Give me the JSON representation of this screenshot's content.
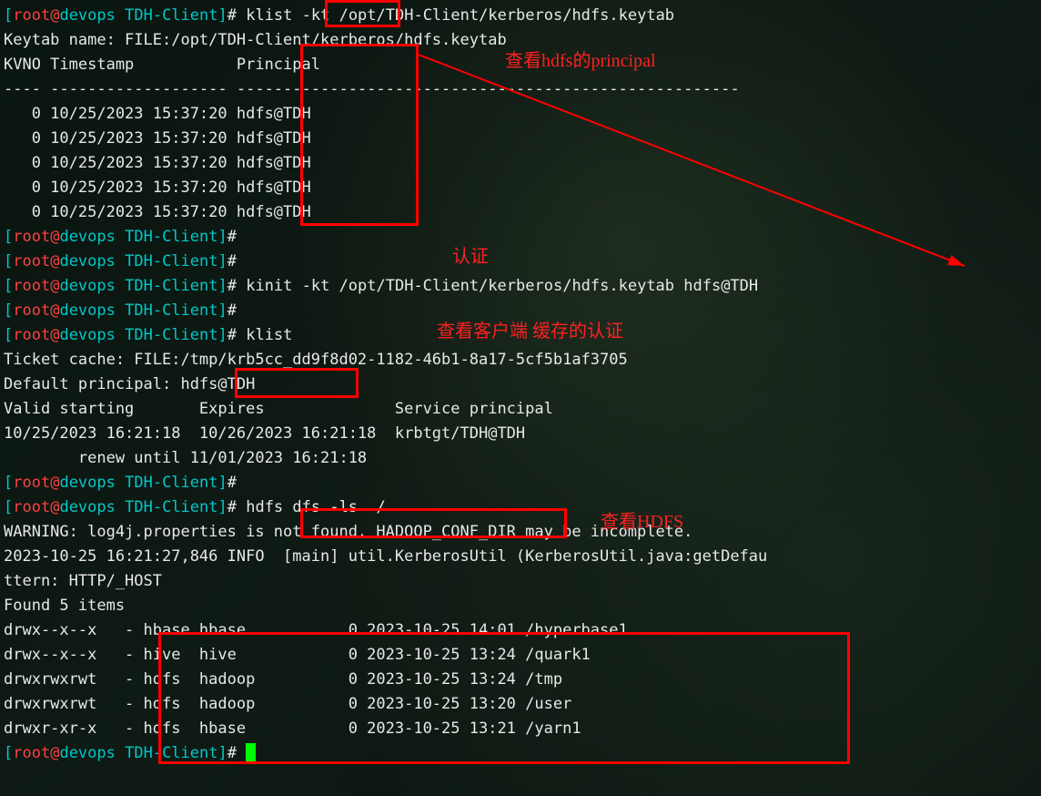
{
  "prompt": {
    "open": "[",
    "user": "root",
    "at": "@",
    "host": "devops",
    "space": " ",
    "dir": "TDH-Client",
    "close": "]",
    "hash": "# "
  },
  "cmd": {
    "klist_kt": "klist ",
    "klist_kt_args": "-kt /opt/TDH-Client/kerberos/hdfs.keytab",
    "kinit": "kinit -kt /opt/TDH-Client/kerberos/hdfs.keytab hdfs@TDH",
    "klist": "klist",
    "hdfs": "hdfs dfs -ls  /"
  },
  "out": {
    "keytab_name": "Keytab name: FILE:/opt/TDH-Client/kerberos/hdfs.keytab",
    "header": "KVNO Timestamp           Principal",
    "dashes": "---- ------------------- ------------------------------------------------------",
    "row1": "   0 10/25/2023 15:37:20 hdfs@TDH",
    "row2": "   0 10/25/2023 15:37:20 hdfs@TDH",
    "row3": "   0 10/25/2023 15:37:20 hdfs@TDH",
    "row4": "   0 10/25/2023 15:37:20 hdfs@TDH",
    "row5": "   0 10/25/2023 15:37:20 hdfs@TDH",
    "ticket_cache": "Ticket cache: FILE:/tmp/krb5cc_dd9f8d02-1182-46b1-8a17-5cf5b1af3705",
    "default_principal": "Default principal: hdfs@TDH",
    "blank": "",
    "valid_header": "Valid starting       Expires              Service principal",
    "valid_row": "10/25/2023 16:21:18  10/26/2023 16:21:18  krbtgt/TDH@TDH",
    "renew": "        renew until 11/01/2023 16:21:18",
    "warn": "WARNING: log4j.properties is not found. HADOOP_CONF_DIR may be incomplete.",
    "info": "2023-10-25 16:21:27,846 INFO  [main] util.KerberosUtil (KerberosUtil.java:getDefau",
    "ttern": "ttern: HTTP/_HOST",
    "found": "Found 5 items",
    "ls1": "drwx--x--x   - hbase hbase           0 2023-10-25 14:01 /hyperbase1",
    "ls2": "drwx--x--x   - hive  hive            0 2023-10-25 13:24 /quark1",
    "ls3": "drwxrwxrwt   - hdfs  hadoop          0 2023-10-25 13:24 /tmp",
    "ls4": "drwxrwxrwt   - hdfs  hadoop          0 2023-10-25 13:20 /user",
    "ls5": "drwxr-xr-x   - hdfs  hbase           0 2023-10-25 13:21 /yarn1"
  },
  "ann": {
    "view_principal": "查看hdfs的principal",
    "auth": "认证",
    "view_cache": "查看客户端 缓存的认证",
    "view_hdfs": "查看HDFS"
  }
}
